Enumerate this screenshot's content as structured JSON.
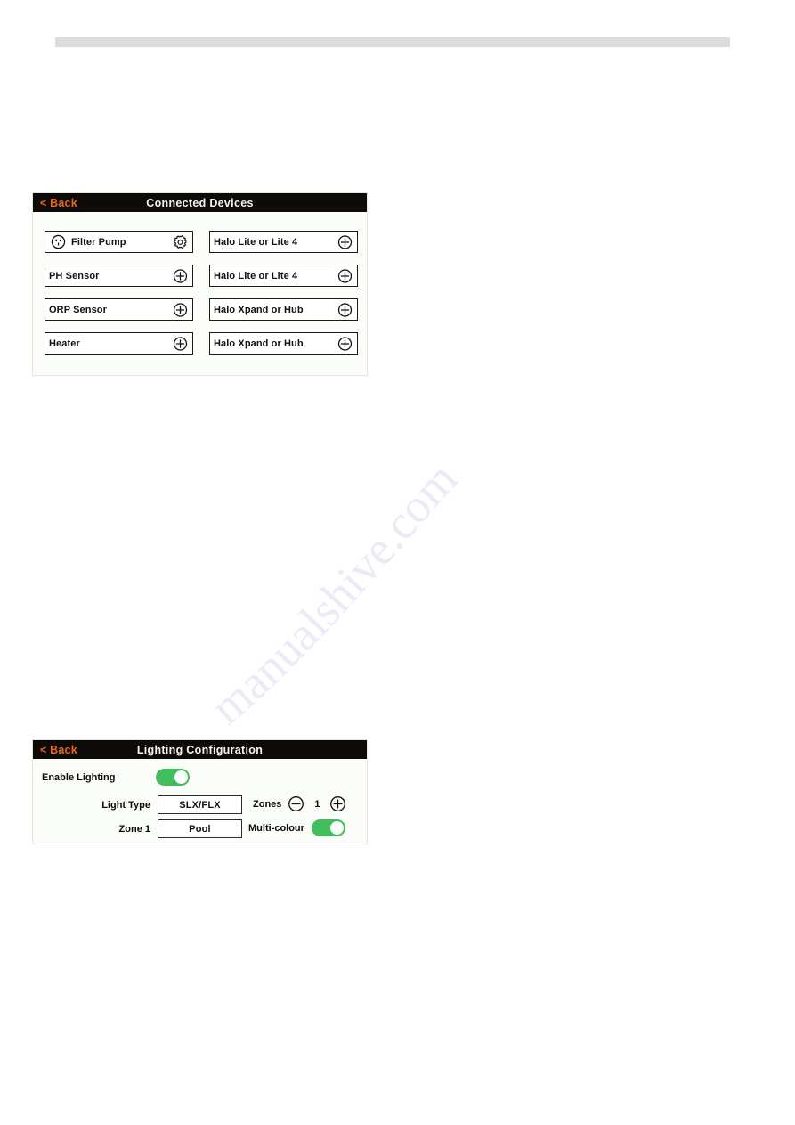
{
  "page": {
    "background": "#ffffff",
    "rule_color": "#dcdcdc"
  },
  "watermark": {
    "text": "manualshive.com"
  },
  "connected_devices_screen": {
    "header": {
      "back_label": "< Back",
      "title": "Connected Devices",
      "title_color": "#f4f4f2",
      "back_color": "#e8661c",
      "background": "#0d0a08"
    },
    "devices": [
      {
        "label": "Filter Pump",
        "lead_icon": "power-outlet-icon",
        "trail_icon": "gear-icon"
      },
      {
        "label": "Halo Lite or Lite 4",
        "lead_icon": null,
        "trail_icon": "plus-circle-icon"
      },
      {
        "label": "PH Sensor",
        "lead_icon": null,
        "trail_icon": "plus-circle-icon"
      },
      {
        "label": "Halo Lite or Lite 4",
        "lead_icon": null,
        "trail_icon": "plus-circle-icon"
      },
      {
        "label": "ORP Sensor",
        "lead_icon": null,
        "trail_icon": "plus-circle-icon"
      },
      {
        "label": "Halo Xpand or Hub",
        "lead_icon": null,
        "trail_icon": "plus-circle-icon"
      },
      {
        "label": "Heater",
        "lead_icon": null,
        "trail_icon": "plus-circle-icon"
      },
      {
        "label": "Halo Xpand or Hub",
        "lead_icon": null,
        "trail_icon": "plus-circle-icon"
      }
    ]
  },
  "lighting_config_screen": {
    "header": {
      "back_label": "< Back",
      "title": "Lighting Configuration",
      "title_color": "#f4f4f2",
      "back_color": "#e8661c",
      "background": "#0d0a08"
    },
    "enable_lighting": {
      "label": "Enable Lighting",
      "state": "on",
      "on_color": "#41bf5e"
    },
    "light_type": {
      "label": "Light Type",
      "value": "SLX/FLX"
    },
    "zone_1": {
      "label": "Zone 1",
      "value": "Pool"
    },
    "zones": {
      "label": "Zones",
      "value": "1",
      "decrement_icon": "minus-circle-icon",
      "increment_icon": "plus-circle-icon"
    },
    "multi_colour": {
      "label": "Multi-colour",
      "state": "on",
      "on_color": "#41bf5e"
    }
  }
}
